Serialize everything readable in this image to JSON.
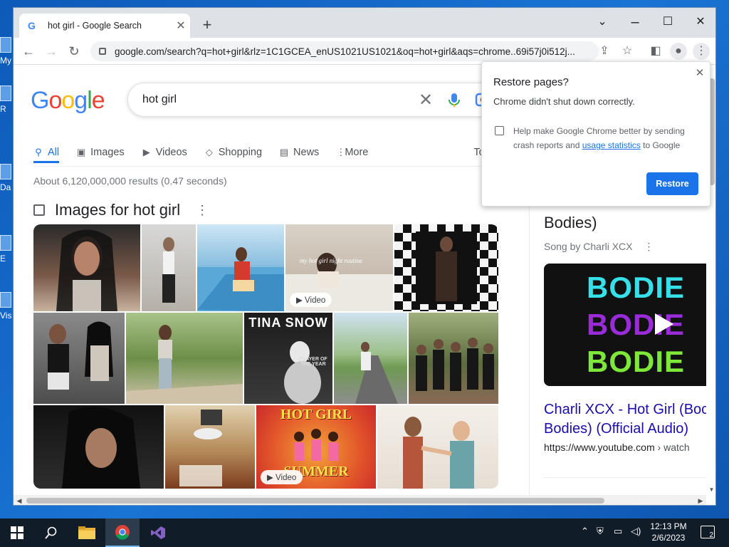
{
  "desktop": {
    "icons": [
      {
        "label": "My"
      },
      {
        "label": "R"
      },
      {
        "label": "Da"
      },
      {
        "label": "E"
      },
      {
        "label": "Vis"
      }
    ]
  },
  "browser": {
    "tab_title": "hot girl - Google Search",
    "url": "google.com/search?q=hot+girl&rlz=1C1GCEA_enUS1021US1021&oq=hot+girl&aqs=chrome..69i57j0i512j..."
  },
  "search": {
    "logo": "Google",
    "query": "hot girl",
    "tabs": [
      {
        "label": "All",
        "icon": "search-icon"
      },
      {
        "label": "Images",
        "icon": "image-icon"
      },
      {
        "label": "Videos",
        "icon": "video-icon"
      },
      {
        "label": "Shopping",
        "icon": "tag-icon"
      },
      {
        "label": "News",
        "icon": "news-icon"
      },
      {
        "label": "More",
        "icon": "more-vert-icon"
      },
      {
        "label": "To"
      }
    ],
    "stats": "About 6,120,000,000 results (0.47 seconds)",
    "images_heading": "Images for hot girl",
    "video_badge": "Video",
    "poster_texts": {
      "tina": "TINA SNOW",
      "hotgirl1": "HOT GIRL",
      "hotgirl2": "SUMMER",
      "tina_sub": "PLAYER OF THE YEAR",
      "caption": "my hot girl night routine"
    }
  },
  "right_panel": {
    "title": "Bodies)",
    "subtitle": "Song by Charli XCX",
    "thumb_word": "BODIE",
    "link": "Charli XCX - Hot Girl (Bodies Bodies) (Official Audio)",
    "link_line1": "Charli XCX - Hot Girl (Boc",
    "link_line2": "Bodies) (Official Audio)",
    "url_host": "https://www.youtube.com",
    "url_path": " › watch"
  },
  "popup": {
    "title": "Restore pages?",
    "message": "Chrome didn't shut down correctly.",
    "checkbox_text": "Help make Google Chrome better by sending crash reports and",
    "checkbox_link": "usage statistics",
    "checkbox_suffix": " to Google",
    "button": "Restore"
  },
  "taskbar": {
    "time": "12:13 PM",
    "date": "2/6/2023",
    "notification_count": "2"
  },
  "colors": {
    "google_blue": "#4285f4",
    "google_red": "#ea4335",
    "google_yellow": "#fbbc05",
    "google_green": "#34a853",
    "accent": "#1a73e8",
    "link": "#1a0dab"
  }
}
